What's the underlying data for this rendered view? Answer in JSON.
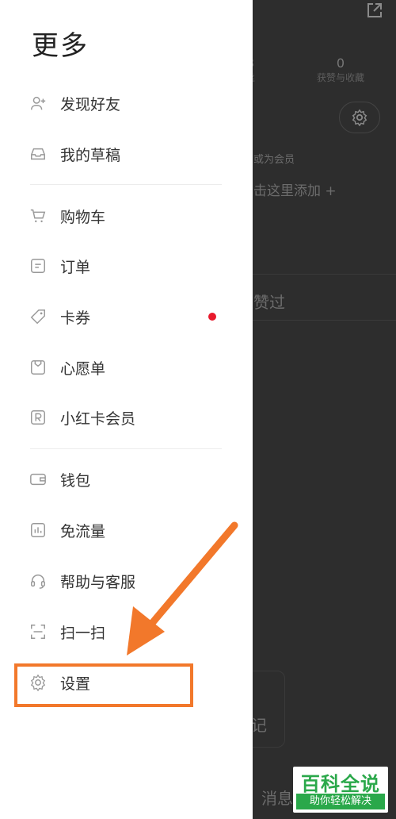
{
  "drawer": {
    "title": "更多",
    "items": [
      {
        "label": "发现好友",
        "icon": "add-person-icon"
      },
      {
        "label": "我的草稿",
        "icon": "inbox-icon"
      },
      {
        "label": "购物车",
        "icon": "cart-icon"
      },
      {
        "label": "订单",
        "icon": "order-icon"
      },
      {
        "label": "卡券",
        "icon": "tag-icon",
        "badge": true
      },
      {
        "label": "心愿单",
        "icon": "wishlist-icon"
      },
      {
        "label": "小红卡会员",
        "icon": "r-badge-icon"
      },
      {
        "label": "钱包",
        "icon": "wallet-icon"
      },
      {
        "label": "免流量",
        "icon": "data-chart-icon"
      },
      {
        "label": "帮助与客服",
        "icon": "headset-icon"
      },
      {
        "label": "扫一扫",
        "icon": "scan-icon"
      },
      {
        "label": "设置",
        "icon": "gear-icon"
      }
    ]
  },
  "background": {
    "stat_left_number": "3",
    "stat_left_label": "丝",
    "stat_right_number": "0",
    "stat_right_label": "获赞与收藏",
    "member_text": "或为会员",
    "add_text": "击这里添加 +",
    "liked_text": "赞过",
    "note_text": "记",
    "messages_text": "消息"
  },
  "watermark": {
    "top": "百科全说",
    "bottom": "助你轻松解决"
  },
  "colors": {
    "highlight": "#f2782b",
    "badge": "#e8192c",
    "watermark_green": "#2aa84a"
  }
}
